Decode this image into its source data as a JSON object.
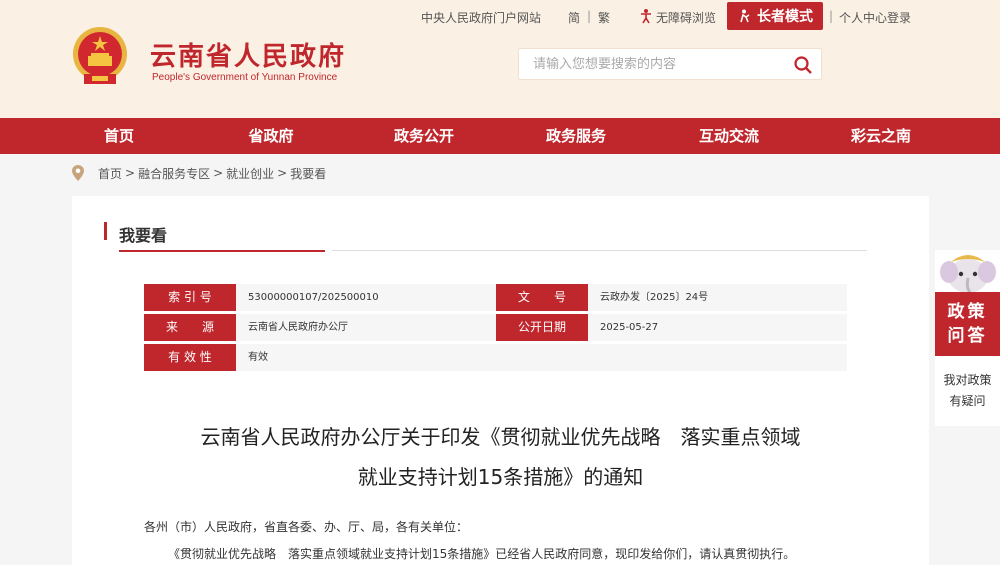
{
  "header": {
    "title": "云南省人民政府",
    "subtitle": "People's Government of Yunnan Province",
    "links": {
      "portal": "中央人民政府门户网站",
      "simplified": "简",
      "traditional": "繁",
      "accessible": "无障碍浏览",
      "elder_mode": "长者模式",
      "login": "个人中心登录",
      "separator": "|"
    },
    "search": {
      "placeholder": "请输入您想要搜索的内容"
    }
  },
  "nav": {
    "items": [
      {
        "label": "首页"
      },
      {
        "label": "省政府"
      },
      {
        "label": "政务公开"
      },
      {
        "label": "政务服务"
      },
      {
        "label": "互动交流"
      },
      {
        "label": "彩云之南"
      }
    ]
  },
  "breadcrumb": {
    "items": [
      "首页",
      "融合服务专区",
      "就业创业",
      "我要看"
    ],
    "separator": ">"
  },
  "section": {
    "title": "我要看"
  },
  "meta": {
    "index_label": "索 引 号",
    "index_value": "53000000107/202500010",
    "doc_no_label": "文　　号",
    "doc_no_value": "云政办发〔2025〕24号",
    "source_label": "来　　源",
    "source_value": "云南省人民政府办公厅",
    "date_label": "公开日期",
    "date_value": "2025-05-27",
    "validity_label": "有 效 性",
    "validity_value": "有效"
  },
  "document": {
    "title_line1": "云南省人民政府办公厅关于印发《贯彻就业优先战略　落实重点领域",
    "title_line2": "就业支持计划15条措施》的通知",
    "salutation": "各州（市）人民政府，省直各委、办、厅、局，各有关单位：",
    "paragraph1": "《贯彻就业优先战略　落实重点领域就业支持计划15条措施》已经省人民政府同意，现印发给你们，请认真贯彻执行。"
  },
  "side": {
    "policy_line1": "政策",
    "policy_line2": "问答",
    "text_line1": "我对政策",
    "text_line2": "有疑问"
  },
  "colors": {
    "brand_red": "#c0272d",
    "header_bg": "#fbf0e4"
  }
}
